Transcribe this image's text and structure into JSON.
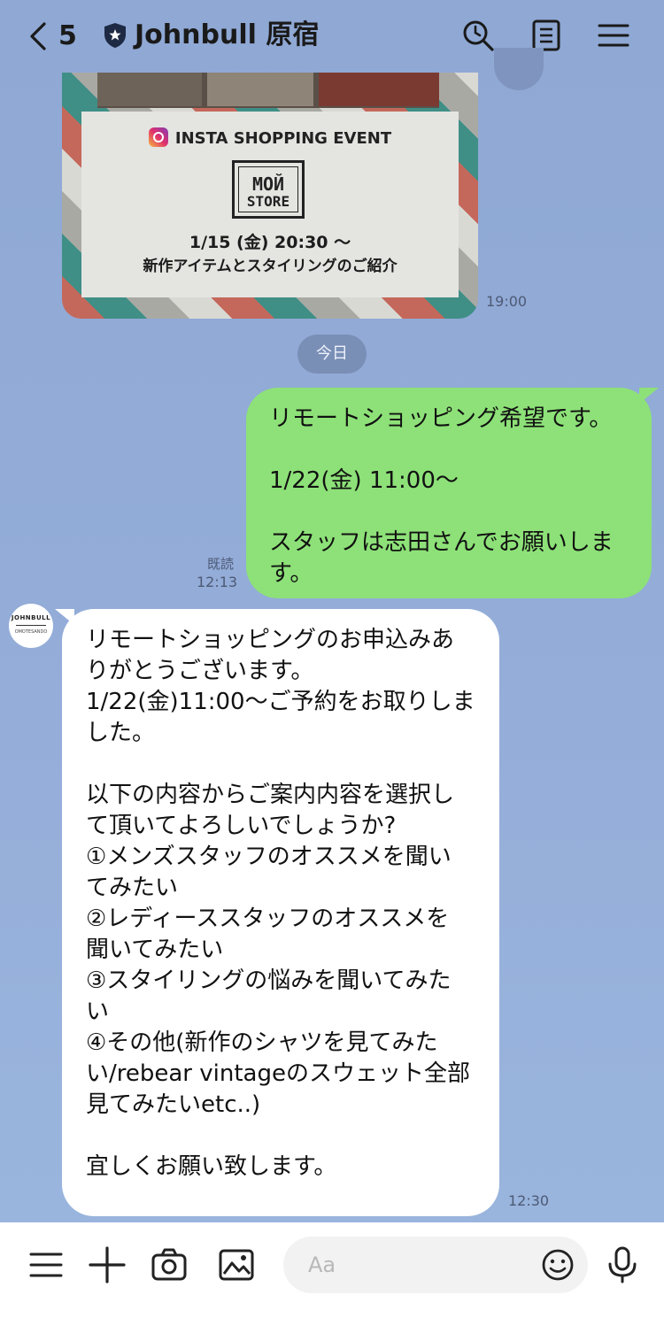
{
  "header": {
    "back_count": "5",
    "title": "Johnbull 原宿",
    "icons": [
      "back-chevron-icon",
      "official-shield-icon",
      "search-icon",
      "notes-icon",
      "menu-icon"
    ]
  },
  "image_message": {
    "event_label": "INSTA SHOPPING EVENT",
    "logo_line1": "MOЙ",
    "logo_line2": "STORE",
    "event_date": "1/15 (金) 20:30 ～",
    "event_desc": "新作アイテムとスタイリングのご紹介",
    "time": "19:00"
  },
  "date_separator": "今日",
  "sent_message": {
    "text": "リモートショッピング希望です。\n\n1/22(金) 11:00～\n\nスタッフは志田さんでお願いしま\nす。",
    "read_label": "既読",
    "time": "12:13"
  },
  "received_message": {
    "avatar_text": "JOHNBULL",
    "avatar_subtext": "OMOTESANDO",
    "text": "リモートショッピングのお申込みあ\nりがとうございます。\n1/22(金)11:00～ご予約をお取りしま\nした。\n\n以下の内容からご案内内容を選択し\nて頂いてよろしいでしょうか?\n①メンズスタッフのオススメを聞い\nてみたい\n②レディーススタッフのオススメを\n聞いてみたい\n③スタイリングの悩みを聞いてみた\nい\n④その他(新作のシャツを見てみた\nい/rebear vintageのスウェット全部\n見てみたいetc..)\n\n宜しくお願い致します。",
    "time": "12:30"
  },
  "input_bar": {
    "placeholder": "Aa",
    "icons": [
      "menu-icon",
      "plus-icon",
      "camera-icon",
      "image-icon",
      "emoji-icon",
      "microphone-icon"
    ]
  },
  "colors": {
    "background": "#93acd8",
    "sent_bubble": "#8de178",
    "received_bubble": "#ffffff"
  }
}
